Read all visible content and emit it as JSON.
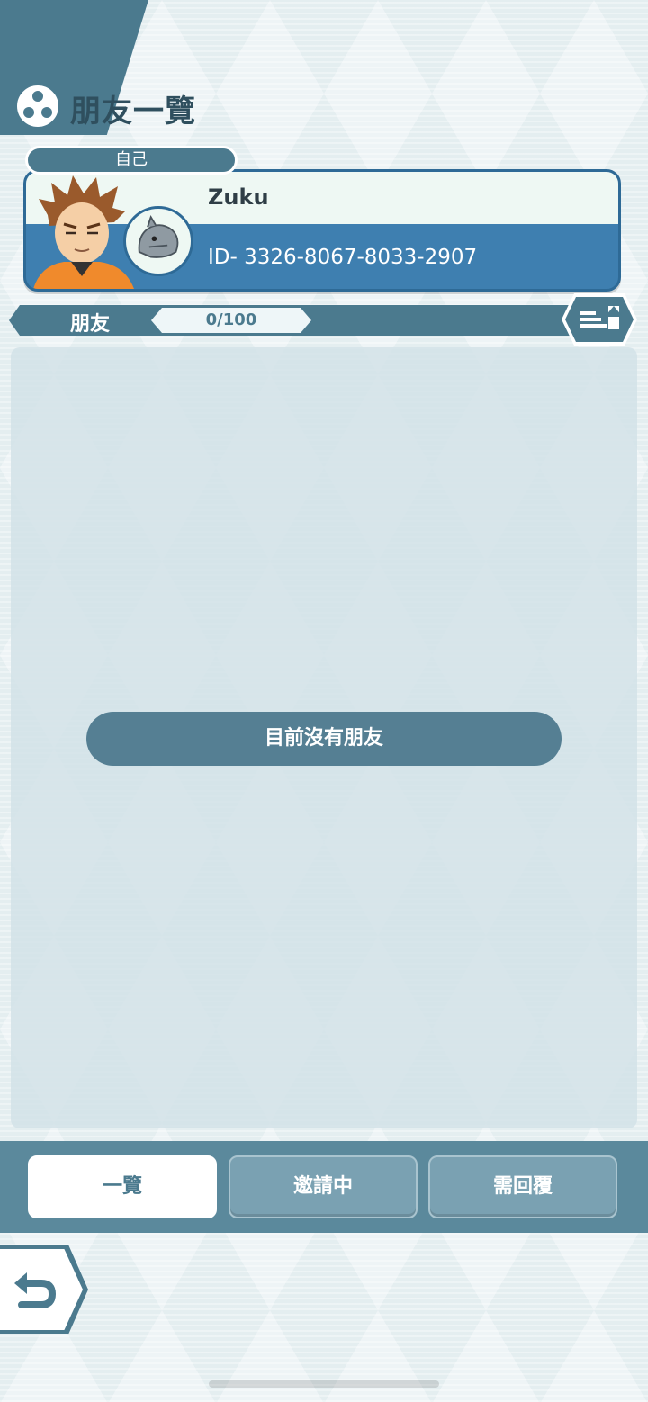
{
  "header": {
    "title": "朋友一覽",
    "icon": "friends-icon"
  },
  "self_card": {
    "tag": "自己",
    "name": "Zuku",
    "id": "ID- 3326-8067-8033-2907",
    "trainer_icon": "trainer-avatar",
    "pokemon_icon": "pokemon-avatar"
  },
  "friends_bar": {
    "label": "朋友",
    "count": "0/100",
    "sort_icon": "sort-icon"
  },
  "list": {
    "empty_message": "目前沒有朋友"
  },
  "tabs": [
    {
      "label": "一覽",
      "active": true
    },
    {
      "label": "邀請中",
      "active": false
    },
    {
      "label": "需回覆",
      "active": false
    }
  ],
  "navigation": {
    "back_icon": "back-icon"
  },
  "colors": {
    "primary": "#4b7a8e",
    "card_blue": "#3e7fb0",
    "background": "#eef4f6"
  }
}
